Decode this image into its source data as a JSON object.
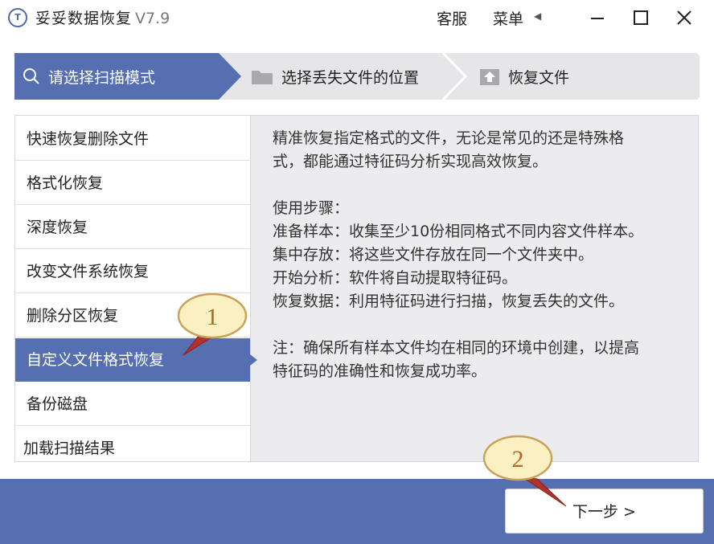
{
  "app": {
    "logo_text": "T",
    "title": "妥妥数据恢复",
    "version": "V7.9"
  },
  "titlebar": {
    "service": "客服",
    "menu": "菜单",
    "menu_arrow": "◀",
    "window_buttons": [
      "minimize-icon",
      "maximize-icon",
      "close-icon"
    ]
  },
  "steps": [
    {
      "label": "请选择扫描模式",
      "icon": "search-icon",
      "active": true
    },
    {
      "label": "选择丢失文件的位置",
      "icon": "folder-icon",
      "active": false
    },
    {
      "label": "恢复文件",
      "icon": "upload-icon",
      "active": false
    }
  ],
  "modes": [
    {
      "label": "快速恢复删除文件",
      "selected": false
    },
    {
      "label": "格式化恢复",
      "selected": false
    },
    {
      "label": "深度恢复",
      "selected": false
    },
    {
      "label": "改变文件系统恢复",
      "selected": false
    },
    {
      "label": "删除分区恢复",
      "selected": false
    },
    {
      "label": "自定义文件格式恢复",
      "selected": true
    },
    {
      "label": "备份磁盘",
      "selected": false
    },
    {
      "label": "加载扫描结果",
      "selected": false
    }
  ],
  "description": {
    "intro_line1": "精准恢复指定格式的文件，无论是常见的还是特殊格",
    "intro_line2": "式，都能通过特征码分析实现高效恢复。",
    "steps_heading": "使用步骤：",
    "step1": "准备样本：收集至少10份相同格式不同内容文件样本。",
    "step2": "集中存放：将这些文件存放在同一个文件夹中。",
    "step3": "开始分析：软件将自动提取特征码。",
    "step4": "恢复数据：利用特征码进行扫描，恢复丢失的文件。",
    "note_line1": "注：确保所有样本文件均在相同的环境中创建，以提高",
    "note_line2": "特征码的准确性和恢复成功率。"
  },
  "footer": {
    "next_label": "下一步 >"
  },
  "callouts": [
    {
      "number": "1"
    },
    {
      "number": "2"
    }
  ],
  "colors": {
    "accent": "#566fb0",
    "step_active": "#566fb0",
    "step_inactive": "#e6e6e8",
    "callout_fill": "#fbf0c2",
    "callout_stroke": "#c9a15a",
    "callout_arrow": "#b0322a"
  }
}
